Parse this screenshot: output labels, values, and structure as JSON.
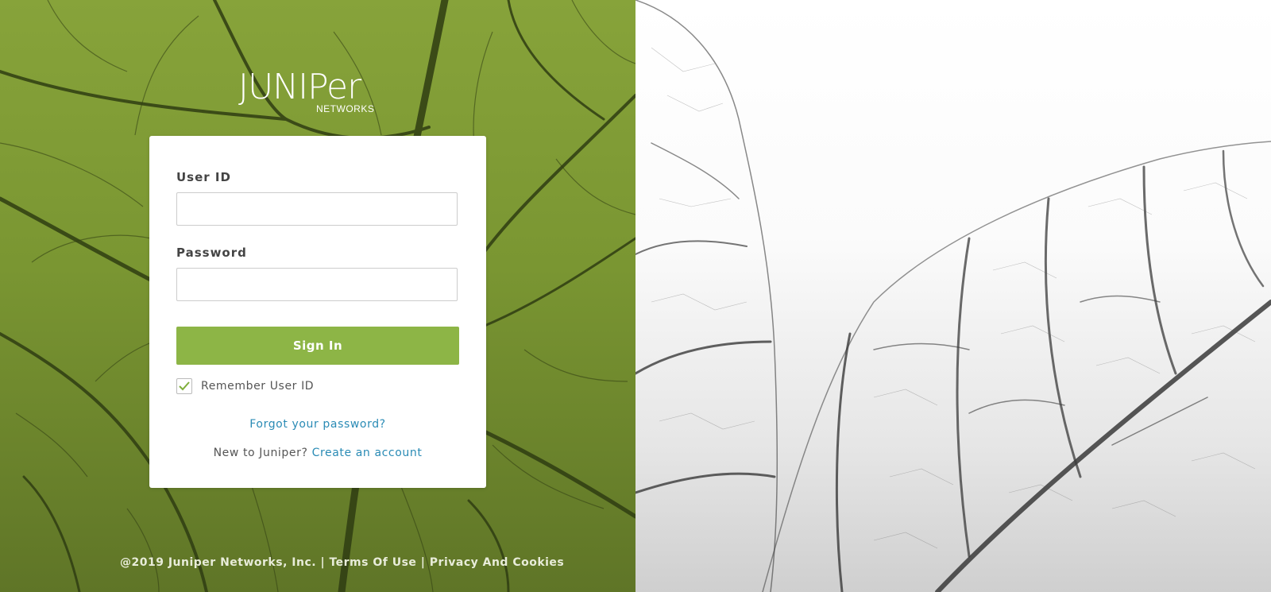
{
  "brand": {
    "logo_word": "JUNIPer",
    "logo_sub": "NETWORKS"
  },
  "login": {
    "user_id_label": "User ID",
    "user_id_value": "",
    "password_label": "Password",
    "password_value": "",
    "signin_label": "Sign In",
    "remember_label": "Remember User ID",
    "remember_checked": true,
    "forgot_label": "Forgot your password?",
    "new_prefix": "New to Juniper?",
    "create_label": "Create an account"
  },
  "footer": {
    "copyright": "@2019 Juniper Networks, Inc.",
    "separator": "|",
    "terms_label": "Terms Of Use",
    "privacy_label": "Privacy And Cookies"
  },
  "colors": {
    "accent_green": "#8db546",
    "link_blue": "#2a8bb5",
    "leaf_green": "#7a9632"
  }
}
